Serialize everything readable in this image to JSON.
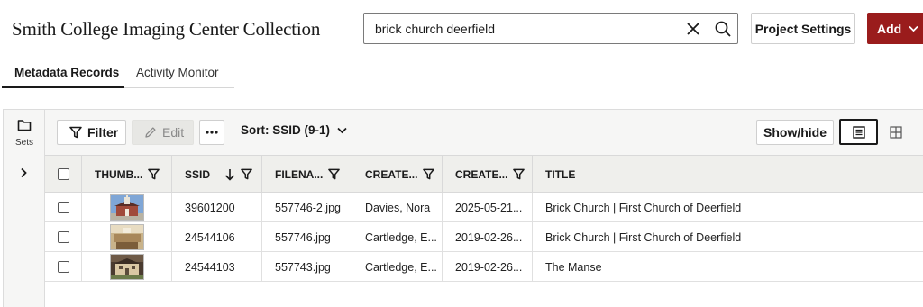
{
  "header": {
    "app_title": "Smith College Imaging Center Collection",
    "search_value": "brick church deerfield",
    "search_icon": "search-icon",
    "clear_icon": "close-icon",
    "project_settings_label": "Project Settings",
    "add_label": "Add"
  },
  "tabs": [
    {
      "label": "Metadata Records",
      "active": true
    },
    {
      "label": "Activity Monitor",
      "active": false
    }
  ],
  "sidebar": {
    "sets_label": "Sets",
    "sets_icon": "folder-icon",
    "expand_icon": "chevron-right-icon"
  },
  "toolbar": {
    "filter_label": "Filter",
    "edit_label": "Edit",
    "more_icon": "more-horizontal-icon",
    "sort_label": "Sort: SSID (9-1)",
    "show_hide_label": "Show/hide",
    "view_list_icon": "list-view-icon",
    "view_grid_icon": "grid-view-icon"
  },
  "table": {
    "columns": [
      "THUMB...",
      "SSID",
      "FILENA...",
      "CREATE...",
      "CREATE...",
      "TITLE"
    ],
    "rows": [
      {
        "ssid": "39601200",
        "filename": "557746-2.jpg",
        "creator": "Davies, Nora",
        "created": "2025-05-21...",
        "title": "Brick Church | First Church of Deerfield",
        "thumb": "thumbnail-church-exterior"
      },
      {
        "ssid": "24544106",
        "filename": "557746.jpg",
        "creator": "Cartledge, E...",
        "created": "2019-02-26...",
        "title": "Brick Church | First Church of Deerfield",
        "thumb": "thumbnail-church-interior"
      },
      {
        "ssid": "24544103",
        "filename": "557743.jpg",
        "creator": "Cartledge, E...",
        "created": "2019-02-26...",
        "title": "The Manse",
        "thumb": "thumbnail-manse"
      }
    ]
  },
  "colors": {
    "accent": "#9a1c1c",
    "header_bg": "#efefec",
    "panel_bg": "#f6f6f5"
  }
}
